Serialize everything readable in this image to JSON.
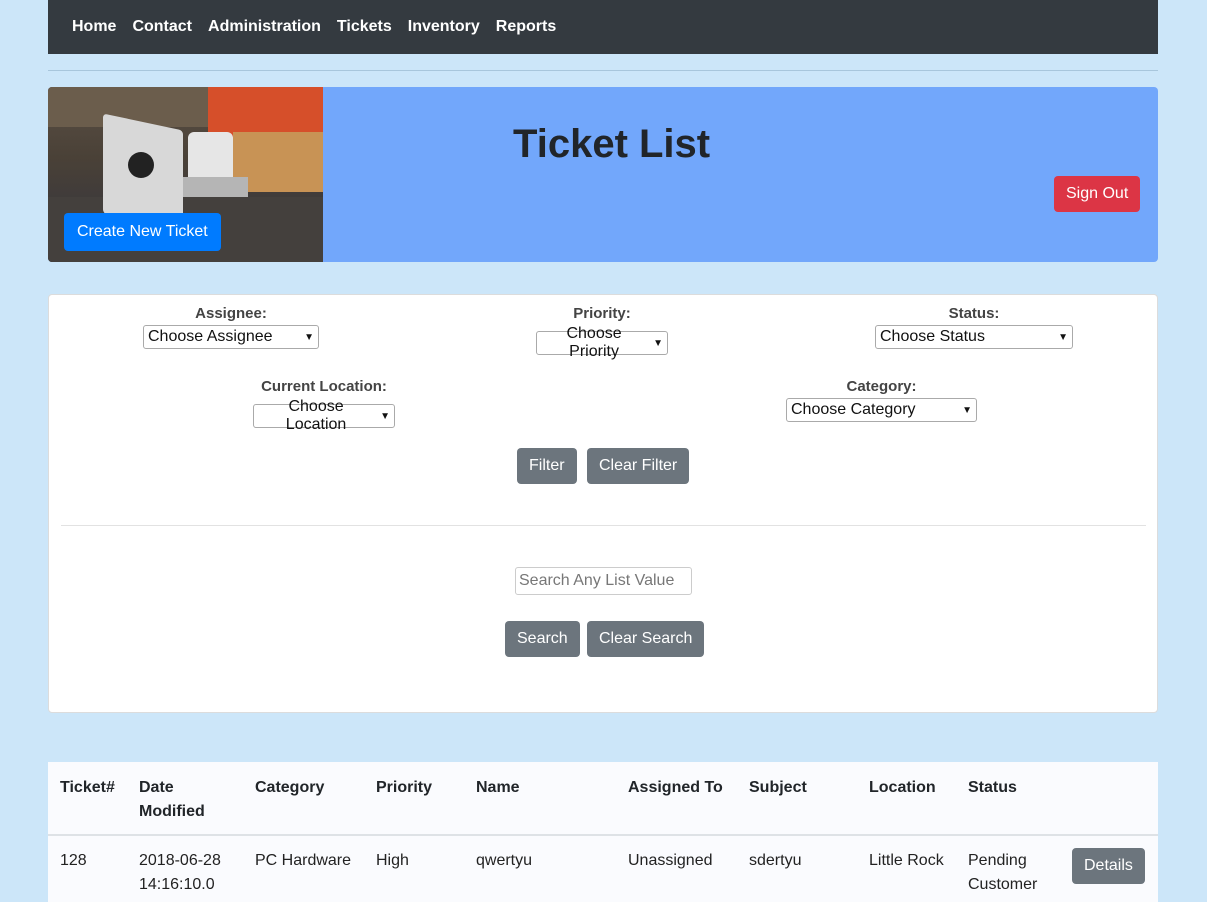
{
  "nav": {
    "items": [
      "Home",
      "Contact",
      "Administration",
      "Tickets",
      "Inventory",
      "Reports"
    ]
  },
  "header": {
    "title": "Ticket List",
    "create_label": "Create New Ticket",
    "signout_label": "Sign Out"
  },
  "filters": {
    "assignee": {
      "label": "Assignee:",
      "value": "Choose Assignee"
    },
    "priority": {
      "label": "Priority:",
      "value": "Choose Priority"
    },
    "status": {
      "label": "Status:",
      "value": "Choose Status"
    },
    "location": {
      "label": "Current Location:",
      "value": "Choose Location"
    },
    "category": {
      "label": "Category:",
      "value": "Choose Category"
    },
    "filter_label": "Filter",
    "clear_filter_label": "Clear Filter"
  },
  "search": {
    "placeholder": "Search Any List Value",
    "search_label": "Search",
    "clear_label": "Clear Search"
  },
  "table": {
    "headers": [
      "Ticket#",
      "Date Modified",
      "Category",
      "Priority",
      "Name",
      "Assigned To",
      "Subject",
      "Location",
      "Status"
    ],
    "rows": [
      {
        "ticket": "128",
        "date": "2018-06-28 14:16:10.0",
        "category": "PC Hardware",
        "priority": "High",
        "name": "qwertyu",
        "assigned": "Unassigned",
        "subject": "sdertyu",
        "location": "Little Rock",
        "status": "Pending Customer",
        "details_label": "Details"
      }
    ]
  },
  "colors": {
    "navbar": "#343a40",
    "banner": "#72a7fb",
    "page_bg": "#cce6f9",
    "primary": "#007bff",
    "danger": "#dc3545",
    "secondary": "#6c757d"
  }
}
